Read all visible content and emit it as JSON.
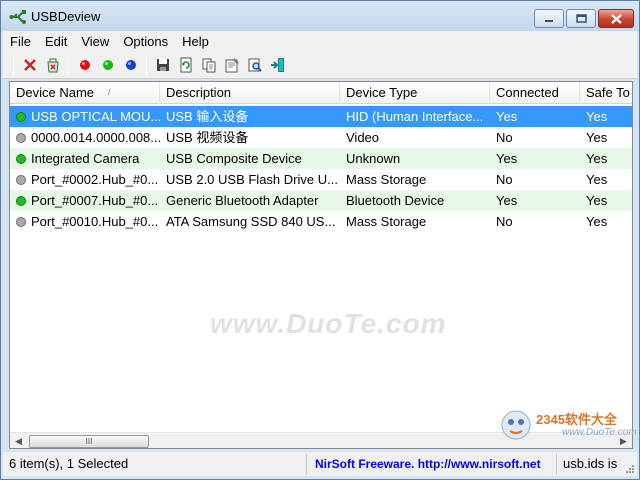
{
  "window": {
    "title": "USBDeview",
    "minimize": "0",
    "maximize": "1",
    "close": "r"
  },
  "menu": [
    "File",
    "Edit",
    "View",
    "Options",
    "Help"
  ],
  "toolbar": [
    {
      "icon": "delete-x-icon",
      "color": "#cc2222"
    },
    {
      "icon": "recycle-icon",
      "color": "#3b7a3b"
    },
    {
      "icon": "red-dot-icon",
      "color": "#dd1111"
    },
    {
      "icon": "green-dot-icon",
      "color": "#11bb11"
    },
    {
      "icon": "blue-dot-icon",
      "color": "#1144cc"
    },
    {
      "icon": "save-icon",
      "color": "#333333"
    },
    {
      "icon": "refresh-icon",
      "color": "#2a8a2a"
    },
    {
      "icon": "copy-icon",
      "color": "#555555"
    },
    {
      "icon": "properties-icon",
      "color": "#555555"
    },
    {
      "icon": "find-icon",
      "color": "#2255aa"
    },
    {
      "icon": "exit-icon",
      "color": "#118888"
    }
  ],
  "columns": [
    "Device Name",
    "Description",
    "Device Type",
    "Connected",
    "Safe To"
  ],
  "sort_indicator": "/",
  "rows": [
    {
      "name": "USB OPTICAL MOU...",
      "description": "USB 输入设备",
      "type": "HID (Human Interface...",
      "connected": "Yes",
      "safe": "Yes",
      "dot": "#22bb22",
      "selected": true
    },
    {
      "name": "0000.0014.0000.008...",
      "description": "USB 视频设备",
      "type": "Video",
      "connected": "No",
      "safe": "Yes",
      "dot": "#aaaaaa",
      "selected": false
    },
    {
      "name": "Integrated Camera",
      "description": "USB Composite Device",
      "type": "Unknown",
      "connected": "Yes",
      "safe": "Yes",
      "dot": "#22bb22",
      "selected": false
    },
    {
      "name": "Port_#0002.Hub_#0...",
      "description": "USB 2.0 USB Flash Drive U...",
      "type": "Mass Storage",
      "connected": "No",
      "safe": "Yes",
      "dot": "#aaaaaa",
      "selected": false
    },
    {
      "name": "Port_#0007.Hub_#0...",
      "description": "Generic Bluetooth Adapter",
      "type": "Bluetooth Device",
      "connected": "Yes",
      "safe": "Yes",
      "dot": "#22bb22",
      "selected": false
    },
    {
      "name": "Port_#0010.Hub_#0...",
      "description": "ATA Samsung SSD 840 US...",
      "type": "Mass Storage",
      "connected": "No",
      "safe": "Yes",
      "dot": "#aaaaaa",
      "selected": false
    }
  ],
  "scrollbar": {
    "thumb_grip": "III"
  },
  "status": {
    "count": "6 item(s), 1 Selected",
    "nirsoft": "NirSoft Freeware.  http://www.nirsoft.net",
    "usbids": "usb.ids is"
  },
  "watermark": {
    "text": "www.DuoTe.com",
    "logo_text": "2345软件大全",
    "logo_url": "www.DuoTe.com"
  },
  "colors": {
    "selection": "#3399ff",
    "alt_row": "#e8f8e6",
    "link": "#0000ff"
  }
}
